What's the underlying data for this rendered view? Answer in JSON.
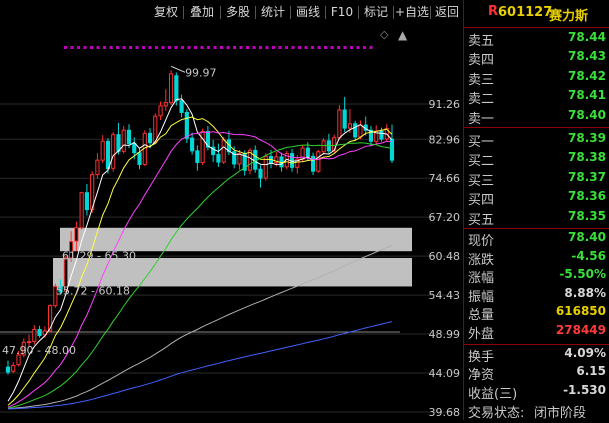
{
  "toolbar": {
    "buttons": [
      "复权",
      "叠加",
      "多股",
      "统计",
      "画线",
      "F10",
      "标记",
      "+自选",
      "返回"
    ]
  },
  "stock": {
    "code": "601127",
    "name": "赛力斯",
    "marker": "R"
  },
  "ask": [
    {
      "label": "卖五",
      "price": "78.44"
    },
    {
      "label": "卖四",
      "price": "78.43"
    },
    {
      "label": "卖三",
      "price": "78.42"
    },
    {
      "label": "卖二",
      "price": "78.41"
    },
    {
      "label": "卖一",
      "price": "78.40"
    }
  ],
  "bid": [
    {
      "label": "买一",
      "price": "78.39"
    },
    {
      "label": "买二",
      "price": "78.38"
    },
    {
      "label": "买三",
      "price": "78.37"
    },
    {
      "label": "买四",
      "price": "78.36"
    },
    {
      "label": "买五",
      "price": "78.35"
    }
  ],
  "quote": [
    {
      "label": "现价",
      "value": "78.40",
      "color": "green"
    },
    {
      "label": "涨跌",
      "value": "-4.56",
      "color": "green"
    },
    {
      "label": "涨幅",
      "value": "-5.50%",
      "color": "green"
    },
    {
      "label": "振幅",
      "value": "8.88%",
      "color": "white"
    },
    {
      "label": "总量",
      "value": "616850",
      "color": "yellow"
    },
    {
      "label": "外盘",
      "value": "278449",
      "color": "red"
    }
  ],
  "stats": [
    {
      "label": "换手",
      "value": "4.09%"
    },
    {
      "label": "净资",
      "value": "6.15"
    },
    {
      "label": "收益(三)",
      "value": "-1.530"
    }
  ],
  "status": {
    "label": "交易状态:",
    "value": "闭市阶段"
  },
  "price_axis": [
    "91.26",
    "82.96",
    "74.66",
    "67.20",
    "60.48",
    "54.43",
    "48.99",
    "44.09",
    "39.68"
  ],
  "annotations": {
    "high": "99.97",
    "zone1": "61.29 - 65.30",
    "zone2": "55.72 - 60.18",
    "zone3": "47.90 - 48.00"
  },
  "colors": {
    "up": "#ff3030",
    "down": "#00d8d8",
    "ma_white": "#ffffff",
    "ma_yellow": "#ffff40",
    "ma_magenta": "#ff40ff",
    "ma_green": "#30d030",
    "ma_gray": "#b0b0b0",
    "ma_blue": "#4060ff",
    "signal_dots": "#c000c0"
  },
  "candles": [
    [
      44.8,
      44.2,
      45.6,
      43.9
    ],
    [
      44.3,
      45.0,
      45.4,
      44.1
    ],
    [
      45.1,
      46.3,
      46.8,
      44.9
    ],
    [
      46.3,
      47.9,
      48.4,
      46.0
    ],
    [
      47.9,
      48.0,
      48.9,
      47.3
    ],
    [
      48.0,
      49.6,
      50.2,
      47.6
    ],
    [
      49.6,
      48.8,
      50.1,
      48.5
    ],
    [
      48.9,
      49.4,
      50.0,
      48.5
    ],
    [
      49.4,
      52.9,
      53.1,
      49.2
    ],
    [
      52.9,
      55.7,
      56.1,
      52.6
    ],
    [
      55.7,
      54.9,
      56.8,
      54.5
    ],
    [
      55.0,
      60.2,
      60.5,
      54.8
    ],
    [
      60.2,
      62.9,
      64.7,
      59.6
    ],
    [
      63.0,
      65.3,
      66.4,
      61.3
    ],
    [
      65.3,
      71.8,
      72.0,
      65.0
    ],
    [
      71.8,
      68.6,
      73.5,
      67.5
    ],
    [
      68.6,
      75.4,
      76.1,
      68.0
    ],
    [
      75.4,
      78.4,
      79.9,
      74.6
    ],
    [
      78.4,
      82.5,
      83.9,
      77.8
    ],
    [
      82.5,
      76.6,
      83.2,
      75.6
    ],
    [
      76.7,
      84.0,
      84.6,
      76.0
    ],
    [
      84.0,
      80.3,
      86.7,
      79.6
    ],
    [
      80.3,
      85.0,
      86.0,
      79.8
    ],
    [
      85.0,
      82.0,
      86.4,
      81.0
    ],
    [
      82.0,
      80.0,
      83.4,
      78.6
    ],
    [
      80.0,
      77.5,
      81.0,
      76.5
    ],
    [
      77.5,
      84.3,
      85.0,
      77.2
    ],
    [
      84.3,
      82.2,
      85.5,
      81.0
    ],
    [
      82.2,
      88.3,
      89.0,
      81.9
    ],
    [
      88.4,
      90.8,
      91.9,
      87.4
    ],
    [
      90.8,
      91.6,
      95.0,
      89.6
    ],
    [
      91.6,
      99.0,
      99.97,
      91.0
    ],
    [
      98.5,
      92.1,
      99.4,
      90.9
    ],
    [
      92.1,
      89.2,
      93.6,
      88.0
    ],
    [
      89.2,
      83.2,
      90.0,
      82.1
    ],
    [
      83.2,
      80.4,
      84.5,
      79.6
    ],
    [
      80.4,
      77.9,
      81.6,
      76.2
    ],
    [
      77.9,
      84.7,
      85.4,
      77.4
    ],
    [
      84.7,
      81.2,
      86.0,
      80.5
    ],
    [
      81.2,
      79.6,
      82.8,
      78.0
    ],
    [
      79.6,
      78.0,
      82.0,
      77.0
    ],
    [
      78.0,
      82.8,
      83.5,
      77.6
    ],
    [
      82.8,
      80.2,
      84.9,
      79.5
    ],
    [
      80.2,
      77.6,
      81.4,
      76.7
    ],
    [
      77.6,
      79.8,
      80.6,
      76.4
    ],
    [
      79.8,
      76.3,
      80.5,
      75.2
    ],
    [
      76.3,
      80.5,
      81.0,
      75.5
    ],
    [
      80.5,
      76.5,
      81.6,
      75.8
    ],
    [
      76.5,
      74.7,
      77.3,
      72.8
    ],
    [
      74.7,
      79.2,
      79.9,
      74.2
    ],
    [
      79.2,
      77.9,
      80.6,
      76.7
    ],
    [
      77.9,
      79.1,
      80.2,
      77.1
    ],
    [
      79.1,
      77.0,
      80.0,
      76.0
    ],
    [
      77.0,
      79.8,
      80.4,
      76.5
    ],
    [
      79.8,
      76.9,
      80.8,
      76.0
    ],
    [
      76.9,
      78.6,
      79.5,
      75.6
    ],
    [
      78.6,
      81.0,
      81.6,
      78.0
    ],
    [
      81.0,
      79.2,
      82.3,
      78.3
    ],
    [
      79.2,
      76.1,
      80.0,
      75.3
    ],
    [
      76.1,
      80.2,
      80.6,
      75.8
    ],
    [
      80.2,
      82.6,
      83.2,
      79.6
    ],
    [
      82.6,
      80.4,
      84.2,
      79.8
    ],
    [
      80.4,
      83.3,
      84.0,
      80.0
    ],
    [
      83.3,
      89.8,
      91.0,
      82.8
    ],
    [
      89.8,
      85.5,
      93.0,
      84.6
    ],
    [
      85.5,
      86.5,
      90.0,
      84.4
    ],
    [
      86.5,
      83.5,
      87.2,
      82.6
    ],
    [
      83.5,
      86.2,
      87.3,
      82.9
    ],
    [
      86.2,
      85.0,
      88.2,
      83.8
    ],
    [
      85.0,
      82.5,
      86.0,
      81.4
    ],
    [
      82.5,
      84.8,
      86.2,
      82.0
    ],
    [
      84.8,
      83.0,
      85.6,
      82.4
    ],
    [
      83.0,
      85.4,
      86.4,
      82.5
    ],
    [
      82.96,
      78.4,
      86.3,
      77.8
    ]
  ]
}
